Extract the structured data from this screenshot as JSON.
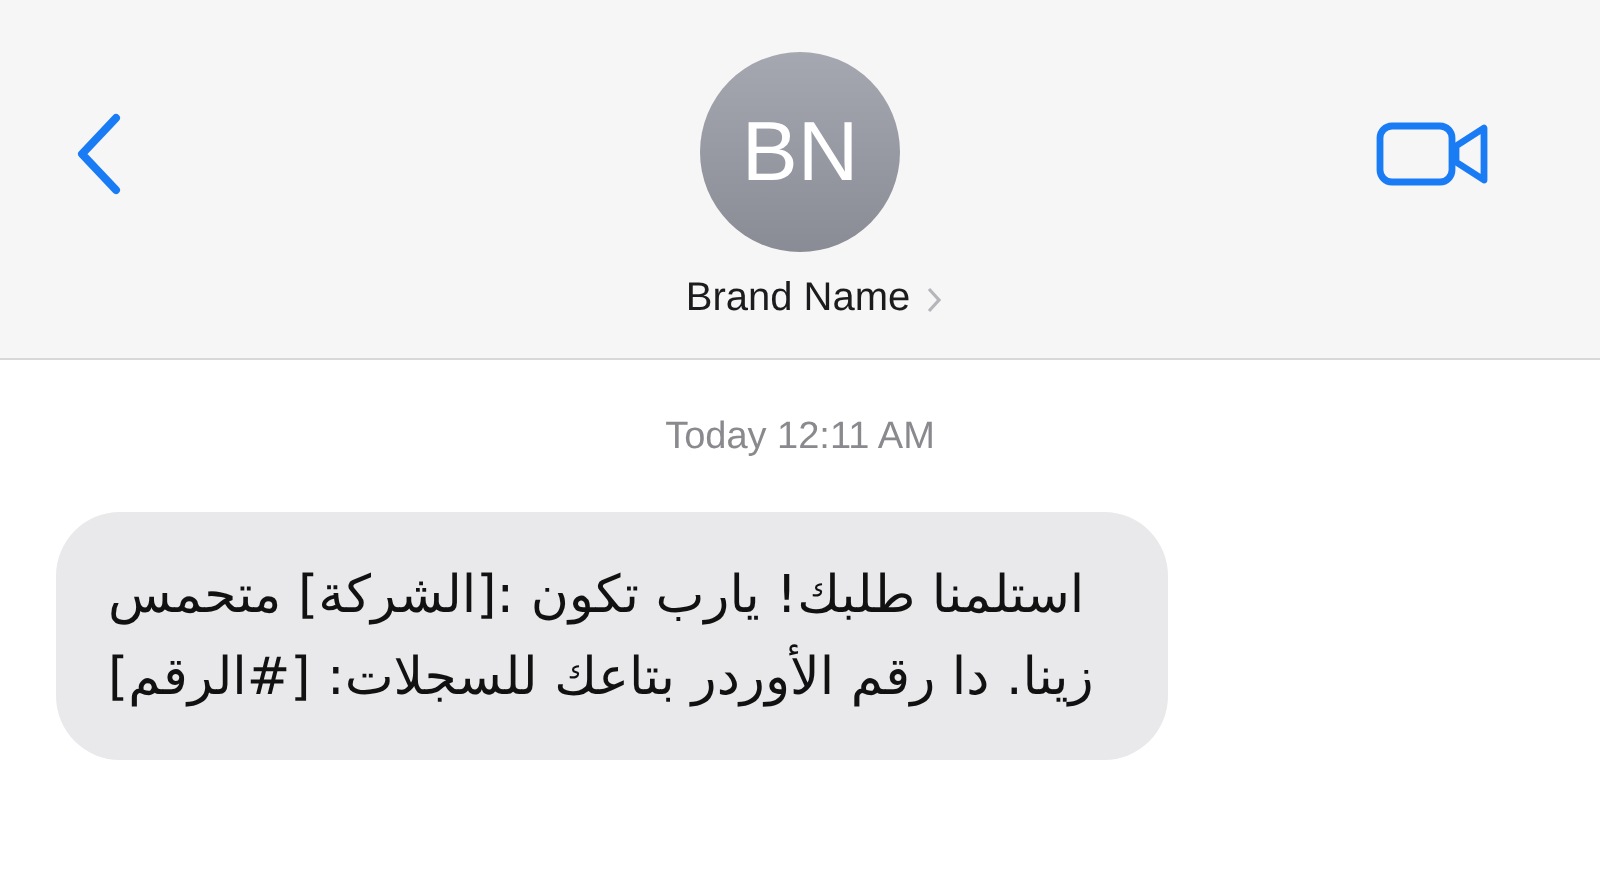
{
  "header": {
    "avatar_initials": "BN",
    "contact_name": "Brand Name"
  },
  "messages": [
    {
      "kind": "timestamp",
      "text": "Today 12:11 AM"
    },
    {
      "kind": "incoming",
      "text": "استلمنا طلبك! يارب تكون :[الشركة] متحمس زينا. دا رقم الأوردر بتاعك للسجلات: [#الرقم]"
    }
  ]
}
